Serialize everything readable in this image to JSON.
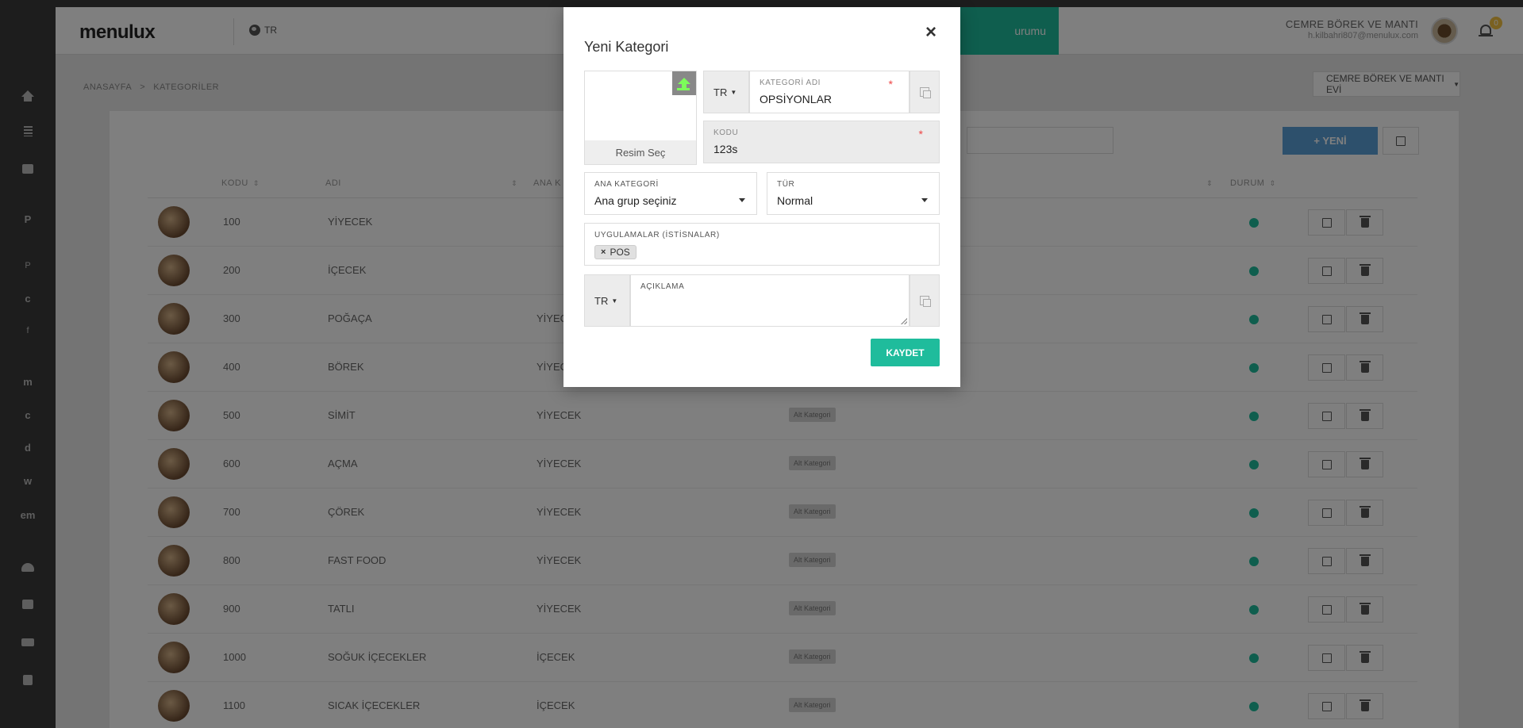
{
  "app": {
    "logo": "menulux",
    "language": "TR"
  },
  "header": {
    "teal_button": "urumu",
    "user_name": "CEMRE BÖREK VE MANTI",
    "user_email": "h.kilbahri807@menulux.com",
    "notification_count": "0"
  },
  "sidebar": {
    "letters": [
      "P",
      "P",
      "c",
      "f",
      "m",
      "c",
      "d",
      "w",
      "em"
    ]
  },
  "breadcrumb": {
    "home": "ANASAYFA",
    "separator": ">",
    "current": "KATEGORİLER"
  },
  "company_select": {
    "value": "CEMRE BÖREK VE MANTI EVİ"
  },
  "toolbar": {
    "new_label": "+ YENİ"
  },
  "table": {
    "headers": {
      "code": "KODU",
      "name": "ADI",
      "parent": "ANA K",
      "status": "DURUM"
    },
    "rows": [
      {
        "code": "100",
        "name": "YİYECEK",
        "parent": "",
        "type": ""
      },
      {
        "code": "200",
        "name": "İÇECEK",
        "parent": "",
        "type": ""
      },
      {
        "code": "300",
        "name": "POĞAÇA",
        "parent": "YİYEC",
        "type": ""
      },
      {
        "code": "400",
        "name": "BÖREK",
        "parent": "YİYEC",
        "type": ""
      },
      {
        "code": "500",
        "name": "SİMİT",
        "parent": "YİYECEK",
        "type": "Alt Kategori"
      },
      {
        "code": "600",
        "name": "AÇMA",
        "parent": "YİYECEK",
        "type": "Alt Kategori"
      },
      {
        "code": "700",
        "name": "ÇÖREK",
        "parent": "YİYECEK",
        "type": "Alt Kategori"
      },
      {
        "code": "800",
        "name": "FAST FOOD",
        "parent": "YİYECEK",
        "type": "Alt Kategori"
      },
      {
        "code": "900",
        "name": "TATLI",
        "parent": "YİYECEK",
        "type": "Alt Kategori"
      },
      {
        "code": "1000",
        "name": "SOĞUK İÇECEKLER",
        "parent": "İÇECEK",
        "type": "Alt Kategori"
      },
      {
        "code": "1100",
        "name": "SICAK İÇECEKLER",
        "parent": "İÇECEK",
        "type": "Alt Kategori"
      }
    ]
  },
  "modal": {
    "title": "Yeni Kategori",
    "close": "×",
    "image_select_label": "Resim Seç",
    "name_lang": "TR",
    "name_label": "KATEGORİ ADI",
    "name_value": "OPSİYONLAR",
    "code_label": "KODU",
    "code_value": "123s",
    "required_mark": "*",
    "parent_label": "ANA KATEGORİ",
    "parent_value": "Ana grup seçiniz",
    "type_label": "TÜR",
    "type_value": "Normal",
    "apps_label": "UYGULAMALAR (İSTİSNALAR)",
    "apps_tag": "POS",
    "desc_lang": "TR",
    "desc_label": "AÇIKLAMA",
    "save_label": "KAYDET"
  },
  "colors": {
    "accent": "#1fbc9c",
    "primary": "#5ba0d8",
    "sidebar": "#3a3a3a"
  }
}
